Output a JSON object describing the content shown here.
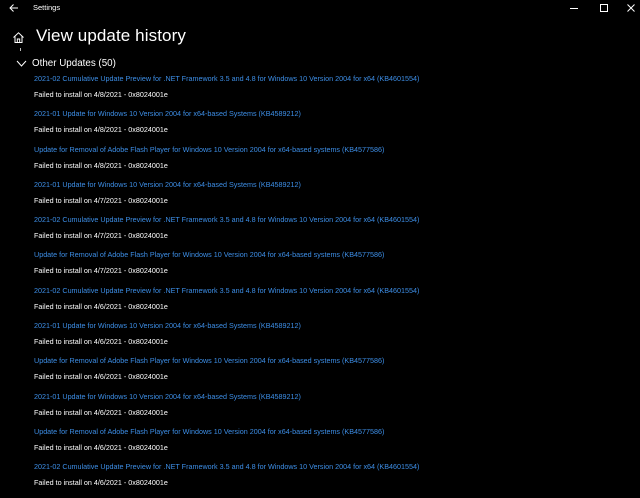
{
  "window": {
    "title": "Settings"
  },
  "page": {
    "title": "View update history"
  },
  "section": {
    "label": "Other Updates (50)"
  },
  "updates": [
    {
      "name": "2021-02 Cumulative Update Preview for .NET Framework 3.5 and 4.8 for Windows 10 Version 2004 for x64 (KB4601554)",
      "status": "Failed to install on 4/8/2021 - 0x8024001e"
    },
    {
      "name": "2021-01 Update for Windows 10 Version 2004 for x64-based Systems (KB4589212)",
      "status": "Failed to install on 4/8/2021 - 0x8024001e"
    },
    {
      "name": "Update for Removal of Adobe Flash Player for Windows 10 Version 2004 for x64-based systems (KB4577586)",
      "status": "Failed to install on 4/8/2021 - 0x8024001e"
    },
    {
      "name": "2021-01 Update for Windows 10 Version 2004 for x64-based Systems (KB4589212)",
      "status": "Failed to install on 4/7/2021 - 0x8024001e"
    },
    {
      "name": "2021-02 Cumulative Update Preview for .NET Framework 3.5 and 4.8 for Windows 10 Version 2004 for x64 (KB4601554)",
      "status": "Failed to install on 4/7/2021 - 0x8024001e"
    },
    {
      "name": "Update for Removal of Adobe Flash Player for Windows 10 Version 2004 for x64-based systems (KB4577586)",
      "status": "Failed to install on 4/7/2021 - 0x8024001e"
    },
    {
      "name": "2021-02 Cumulative Update Preview for .NET Framework 3.5 and 4.8 for Windows 10 Version 2004 for x64 (KB4601554)",
      "status": "Failed to install on 4/6/2021 - 0x8024001e"
    },
    {
      "name": "2021-01 Update for Windows 10 Version 2004 for x64-based Systems (KB4589212)",
      "status": "Failed to install on 4/6/2021 - 0x8024001e"
    },
    {
      "name": "Update for Removal of Adobe Flash Player for Windows 10 Version 2004 for x64-based systems (KB4577586)",
      "status": "Failed to install on 4/6/2021 - 0x8024001e"
    },
    {
      "name": "2021-01 Update for Windows 10 Version 2004 for x64-based Systems (KB4589212)",
      "status": "Failed to install on 4/6/2021 - 0x8024001e"
    },
    {
      "name": "Update for Removal of Adobe Flash Player for Windows 10 Version 2004 for x64-based systems (KB4577586)",
      "status": "Failed to install on 4/6/2021 - 0x8024001e"
    },
    {
      "name": "2021-02 Cumulative Update Preview for .NET Framework 3.5 and 4.8 for Windows 10 Version 2004 for x64 (KB4601554)",
      "status": "Failed to install on 4/6/2021 - 0x8024001e"
    }
  ],
  "colors": {
    "background": "#000000",
    "link": "#3d8ee6",
    "text": "#ffffff"
  },
  "icons": {
    "back": "back-arrow-icon",
    "home": "home-icon",
    "minimize": "minimize-icon",
    "maximize": "maximize-icon",
    "close": "close-icon",
    "expand": "chevron-down-icon"
  }
}
